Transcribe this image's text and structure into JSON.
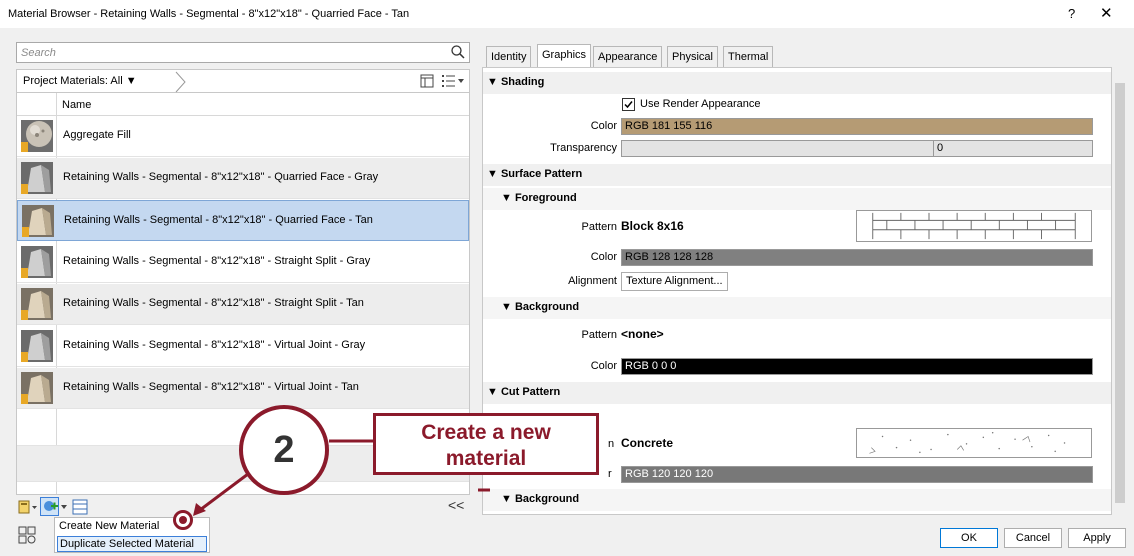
{
  "window": {
    "title": "Material Browser - Retaining Walls - Segmental - 8\"x12\"x18\" - Quarried Face - Tan",
    "help_label": "?",
    "close_label": "✕"
  },
  "left": {
    "search_placeholder": "Search",
    "project_label": "Project Materials: All ▼",
    "column_header": "Name",
    "materials": [
      {
        "name": "Aggregate Fill",
        "thumb": "sphere-thumbnail"
      },
      {
        "name": "Retaining Walls - Segmental - 8\"x12\"x18\" -  Quarried Face - Gray",
        "thumb": "gray-block-thumbnail"
      },
      {
        "name": "Retaining Walls - Segmental - 8\"x12\"x18\" - Quarried Face - Tan",
        "thumb": "tan-block-thumbnail",
        "selected": true
      },
      {
        "name": "Retaining Walls - Segmental - 8\"x12\"x18\" - Straight Split - Gray",
        "thumb": "gray-block-thumbnail"
      },
      {
        "name": "Retaining Walls - Segmental - 8\"x12\"x18\" - Straight Split - Tan",
        "thumb": "tan-block-thumbnail"
      },
      {
        "name": "Retaining Walls - Segmental - 8\"x12\"x18\" - Virtual Joint - Gray",
        "thumb": "gray-block-thumbnail"
      },
      {
        "name": "Retaining Walls - Segmental - 8\"x12\"x18\" - Virtual Joint - Tan",
        "thumb": "tan-block-thumbnail"
      }
    ],
    "collapse_label": "<<",
    "menu": {
      "create_new": "Create New Material",
      "duplicate": "Duplicate Selected Material"
    }
  },
  "tabs": [
    {
      "label": "Identity",
      "active": false
    },
    {
      "label": "Graphics",
      "active": true
    },
    {
      "label": "Appearance",
      "active": false
    },
    {
      "label": "Physical",
      "active": false
    },
    {
      "label": "Thermal",
      "active": false
    }
  ],
  "graphics": {
    "shading": {
      "header": "▼ Shading",
      "use_render_label": "Use Render Appearance",
      "use_render_checked": true,
      "color_label": "Color",
      "color_value": "RGB 181 155 116",
      "color_hex": "#b59b74",
      "transparency_label": "Transparency",
      "transparency_value": "0"
    },
    "surface_pattern": {
      "header": "▼ Surface Pattern",
      "foreground": {
        "header": "▼ Foreground",
        "pattern_label": "Pattern",
        "pattern_value": "Block 8x16",
        "color_label": "Color",
        "color_value": "RGB 128 128 128",
        "color_hex": "#808080",
        "alignment_label": "Alignment",
        "alignment_button": "Texture Alignment..."
      },
      "background": {
        "header": "▼ Background",
        "pattern_label": "Pattern",
        "pattern_value": "<none>",
        "color_label": "Color",
        "color_value": "RGB 0 0 0",
        "color_hex": "#000000"
      }
    },
    "cut_pattern": {
      "header": "▼ Cut Pattern",
      "foreground": {
        "pattern_label_partial": "n",
        "pattern_value": "Concrete",
        "color_label_partial": "r",
        "color_value": "RGB 120 120 120",
        "color_hex": "#787878"
      },
      "background": {
        "header": "▼ Background"
      }
    }
  },
  "footer": {
    "ok": "OK",
    "cancel": "Cancel",
    "apply": "Apply"
  },
  "annotation": {
    "step_number": "2",
    "callout_line1": "Create a new",
    "callout_line2": "material",
    "accent_color": "#8b1a2b"
  }
}
